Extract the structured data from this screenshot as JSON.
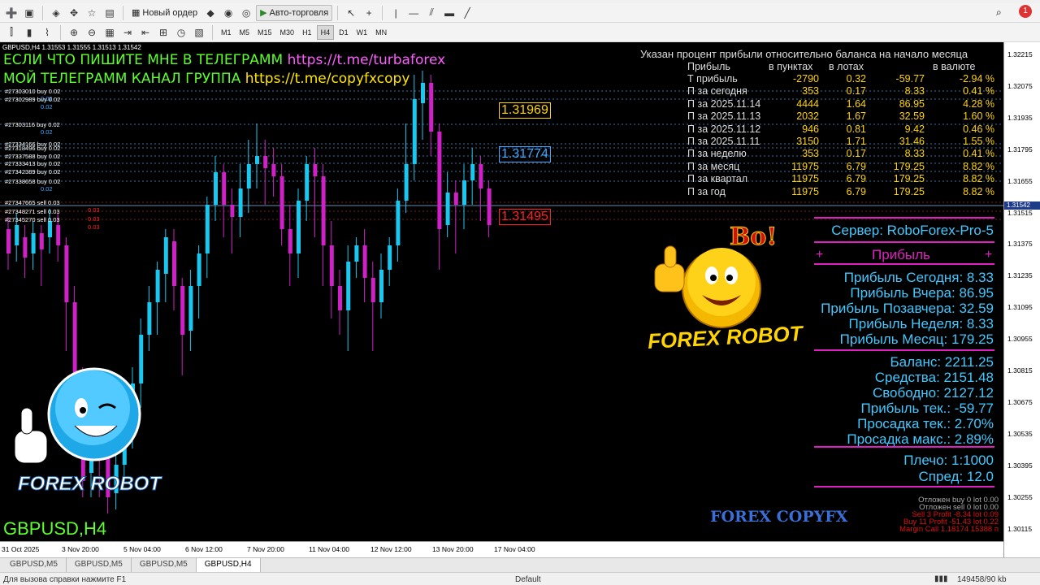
{
  "toolbar1": {
    "new_order": "Новый ордер",
    "autotrading": "Авто-торговля"
  },
  "toolbar2": {
    "timeframes": [
      "M1",
      "M5",
      "M15",
      "M30",
      "H1",
      "H4",
      "D1",
      "W1",
      "MN"
    ],
    "active_timeframe": "H4"
  },
  "chart": {
    "header": "GBPUSD,H4  1.31553 1.31555 1.31513 1.31542",
    "telegram_line1_text": "ЕСЛИ ЧТО ПИШИТЕ МНЕ В ТЕЛЕГРАММ",
    "telegram_line1_link": "https://t.me/turbaforex",
    "telegram_line2_text": "МОЙ ТЕЛЕГРАММ КАНАЛ ГРУППА",
    "telegram_line2_link": "https://t.me/copyfxcopy",
    "symbol_label": "GBPUSD,H4",
    "watermark": "FOREX COPYFX",
    "robot_caption_left": "FOREX ROBOT",
    "robot_caption_right": "FOREX ROBOT",
    "robot_exclaim": "Bo!",
    "levels": [
      "1.31969",
      "1.31774",
      "1.31495"
    ],
    "orders": [
      {
        "id": "#27303010 buy 0.02",
        "lot": "0.02"
      },
      {
        "id": "#27302989 buy 0.02",
        "lot": "0.02"
      },
      {
        "id": "#27303116 buy 0.02",
        "lot": "0.02"
      },
      {
        "id": "#27334166 buy 0.02",
        "lot": ""
      },
      {
        "id": "#27318496 buy 0.02",
        "lot": ""
      },
      {
        "id": "#27337588 buy 0.02",
        "lot": ""
      },
      {
        "id": "#27333413 buy 0.02",
        "lot": ""
      },
      {
        "id": "#27342389 buy 0.02",
        "lot": ""
      },
      {
        "id": "#27338658 buy 0.02",
        "lot": "0.02"
      },
      {
        "id": "#27347665 sell 0.03",
        "lot": "0.03"
      },
      {
        "id": "#27348271 sell 0.03",
        "lot": "0.03"
      },
      {
        "id": "#27345270 sell 0.03",
        "lot": "0.03"
      }
    ]
  },
  "stats": {
    "title": "Указан процент прибыли относительно баланса на начало месяца",
    "headers": [
      "Прибыль",
      "в пунктах",
      "в лотах",
      "",
      "в валюте"
    ],
    "rows": [
      {
        "label": "Т прибыль",
        "points": "-2790",
        "lots": "0.32",
        "money": "-59.77",
        "pct": "-2.94 %"
      },
      {
        "label": "П за сегодня",
        "points": "353",
        "lots": "0.17",
        "money": "8.33",
        "pct": "0.41 %"
      },
      {
        "label": "П за 2025.11.14",
        "points": "4444",
        "lots": "1.64",
        "money": "86.95",
        "pct": "4.28 %"
      },
      {
        "label": "П за 2025.11.13",
        "points": "2032",
        "lots": "1.67",
        "money": "32.59",
        "pct": "1.60 %"
      },
      {
        "label": "П за 2025.11.12",
        "points": "946",
        "lots": "0.81",
        "money": "9.42",
        "pct": "0.46 %"
      },
      {
        "label": "П за 2025.11.11",
        "points": "3150",
        "lots": "1.71",
        "money": "31.46",
        "pct": "1.55 %"
      },
      {
        "label": "П за неделю",
        "points": "353",
        "lots": "0.17",
        "money": "8.33",
        "pct": "0.41 %"
      },
      {
        "label": "П за месяц",
        "points": "11975",
        "lots": "6.79",
        "money": "179.25",
        "pct": "8.82 %"
      },
      {
        "label": "П за квартал",
        "points": "11975",
        "lots": "6.79",
        "money": "179.25",
        "pct": "8.82 %"
      },
      {
        "label": "П за год",
        "points": "11975",
        "lots": "6.79",
        "money": "179.25",
        "pct": "8.82 %"
      }
    ]
  },
  "info": {
    "server": "Сервер: RoboForex-Pro-5",
    "profit_header": "Прибыль",
    "plus": "+",
    "profit_lines": [
      "Прибыль Сегодня: 8.33",
      "Прибыль Вчера: 86.95",
      "Прибыль Позавчера: 32.59",
      "Прибыль Неделя: 8.33",
      "Прибыль Месяц: 179.25"
    ],
    "account_lines": [
      "Баланс: 2211.25",
      "Средства: 2151.48",
      "Свободно: 2127.12",
      "Прибыль тек.:  -59.77",
      "Просадка тек.:  2.70%",
      "Просадка макс.:  2.89%"
    ],
    "leverage_lines": [
      "Плечо: 1:1000",
      "Спред: 12.0"
    ],
    "pending_buy": "Отложен buy 0    lot 0.00",
    "pending_sell": "Отложен sell 0    lot 0.00",
    "sell_line": "Sell 3   Profit -8.34   lot 0.09",
    "buy_line": "Buy 11   Profit -51.43   lot 0.22",
    "margin_call": "Margin Call 1.18174   15388 п"
  },
  "price_scale": [
    "1.32215",
    "1.32075",
    "1.31935",
    "1.31795",
    "1.31655",
    "1.31515",
    "1.31375",
    "1.31235",
    "1.31095",
    "1.30955",
    "1.30815",
    "1.30675",
    "1.30535",
    "1.30395",
    "1.30255",
    "1.30115"
  ],
  "current_price": "1.31542",
  "time_scale": [
    "31 Oct 2025",
    "3 Nov 20:00",
    "5 Nov 04:00",
    "6 Nov 12:00",
    "7 Nov 20:00",
    "11 Nov 04:00",
    "12 Nov 12:00",
    "13 Nov 20:00",
    "17 Nov 04:00"
  ],
  "tabs": [
    "GBPUSD,M5",
    "GBPUSD,M5",
    "GBPUSD,M5",
    "GBPUSD,H4"
  ],
  "active_tab": 3,
  "status": {
    "help": "Для вызова справки нажмите F1",
    "profile": "Default",
    "traffic": "149458/90 kb"
  },
  "colors": {
    "bull": "#18c8f0",
    "bear": "#d020c8",
    "table_value": "#ffd400",
    "table_label": "#dddddd",
    "info_text": "#41c9ff",
    "magenta": "#e020c0"
  }
}
